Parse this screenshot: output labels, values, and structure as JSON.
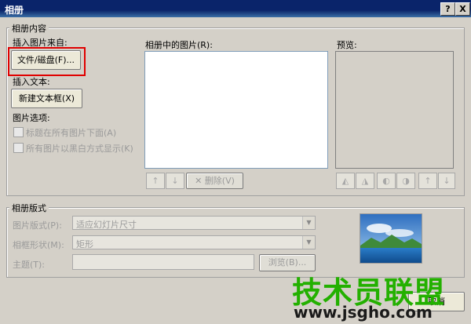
{
  "window": {
    "title": "相册",
    "help_label": "?",
    "close_label": "X"
  },
  "album_content": {
    "group_label": "相册内容",
    "insert_from_label": "插入图片来自:",
    "file_disk_button": "文件/磁盘(F)...",
    "insert_text_label": "插入文本:",
    "new_textbox_button": "新建文本框(X)",
    "picture_options_label": "图片选项:",
    "option_caption": "标题在所有图片下面(A)",
    "option_bw": "所有图片以黑白方式显示(K)",
    "pictures_label": "相册中的图片(R):",
    "remove_button": "删除(V)",
    "preview_label": "预览:"
  },
  "album_layout": {
    "group_label": "相册版式",
    "picture_layout_label": "图片版式(P):",
    "picture_layout_value": "适应幻灯片尺寸",
    "frame_shape_label": "相框形状(M):",
    "frame_shape_value": "矩形",
    "theme_label": "主题(T):",
    "theme_value": "",
    "browse_button": "浏览(B)..."
  },
  "footer": {
    "cancel_button": "取消"
  },
  "watermark": {
    "text": "技术员联盟",
    "url": "www.jsgho.com"
  },
  "colors": {
    "highlight": "#e00000",
    "title_bar": "#0a246a",
    "watermark": "#23b000"
  }
}
